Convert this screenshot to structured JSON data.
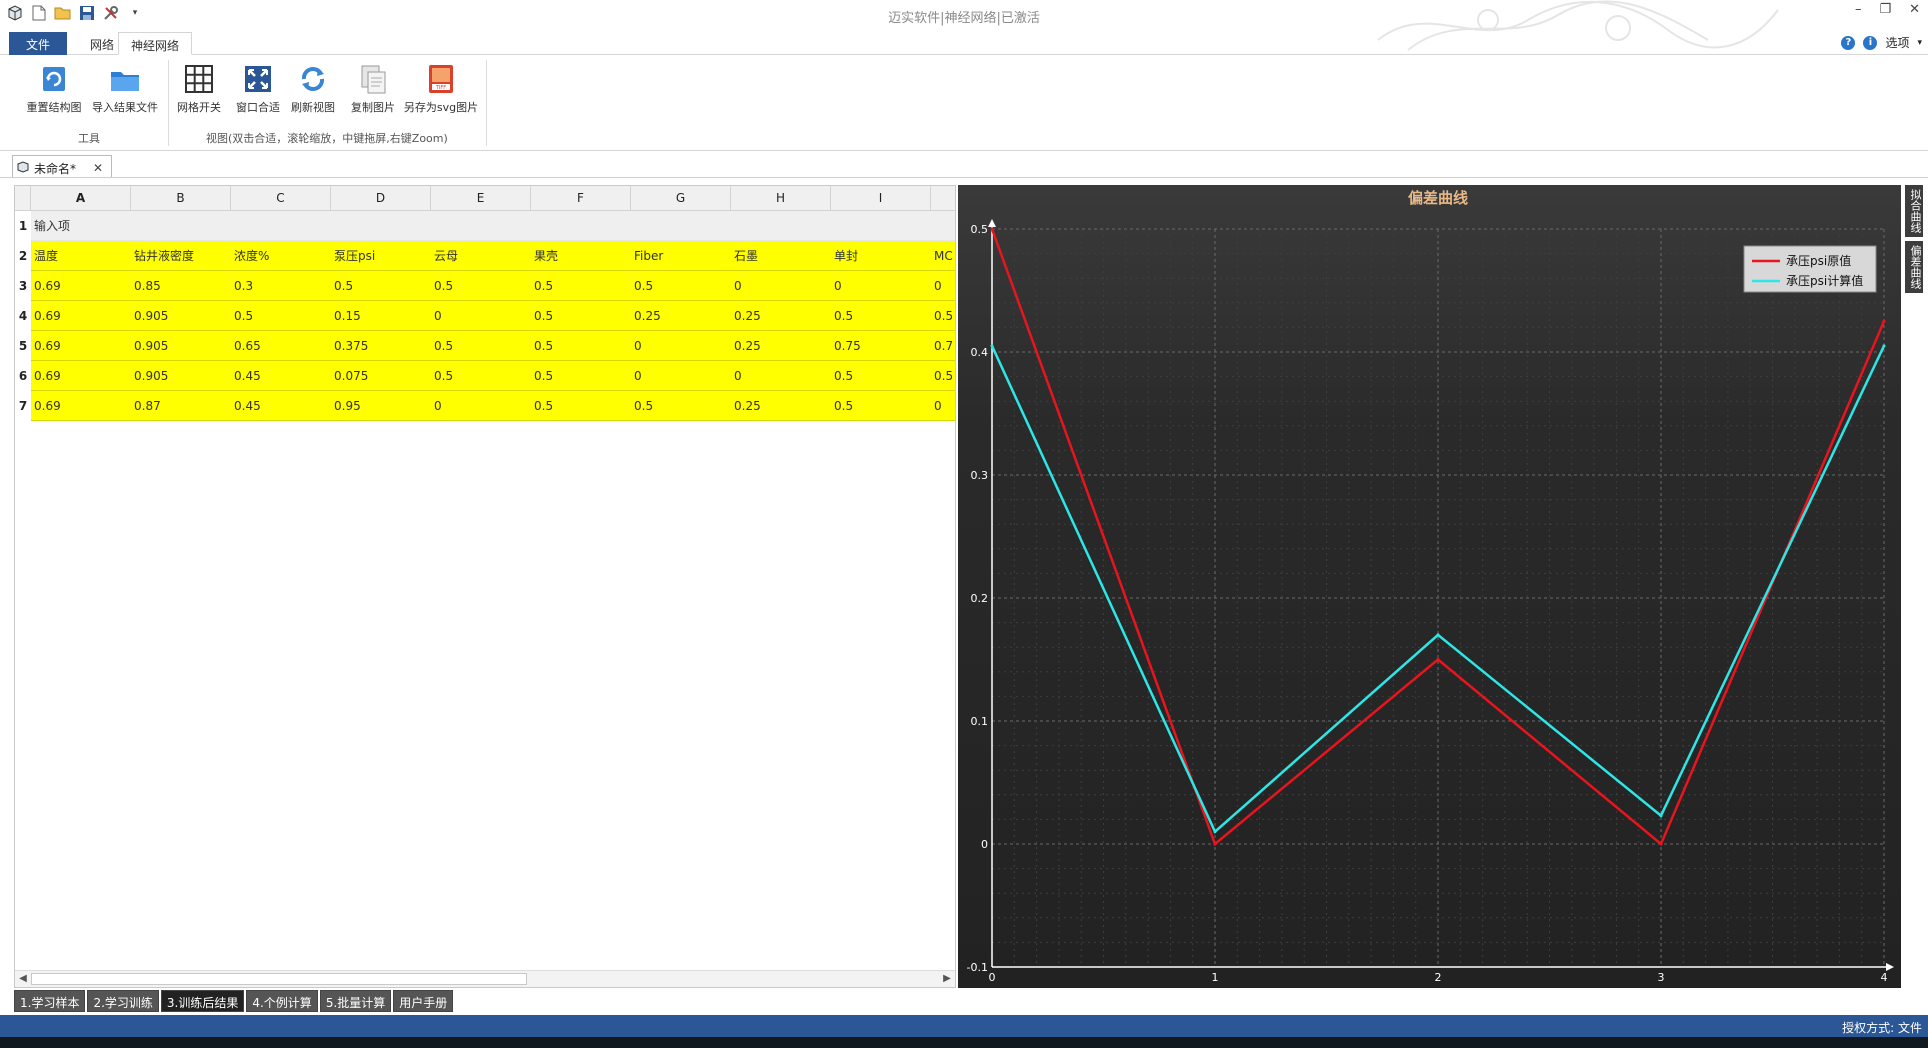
{
  "window": {
    "title": "迈实软件|神经网络|已激活",
    "controls": [
      "–",
      "❐",
      "✕"
    ]
  },
  "ribbon": {
    "tabs": [
      {
        "label": "文件"
      },
      {
        "label": "网络"
      },
      {
        "label": "神经网络"
      }
    ],
    "options_label": "选项",
    "buttons": {
      "reset_structure": "重置结构图",
      "import_result": "导入结果文件",
      "grid_toggle": "网格开关",
      "fit_window": "窗口合适",
      "refresh_view": "刷新视图",
      "copy_image": "复制图片",
      "save_svg": "另存为svg图片"
    },
    "groups": {
      "tools": "工具",
      "view": "视图(双击合适，滚轮缩放，中键拖屏,右键Zoom)"
    }
  },
  "doc_tab": {
    "label": "未命名*"
  },
  "sheet": {
    "columns": [
      "A",
      "B",
      "C",
      "D",
      "E",
      "F",
      "G",
      "H",
      "I"
    ],
    "row_numbers": [
      "1",
      "2",
      "3",
      "4",
      "5",
      "6",
      "7"
    ],
    "row1": "输入项",
    "headers": [
      "温度",
      "钻井液密度",
      "浓度%",
      "泵压psi",
      "云母",
      "果壳",
      "Fiber",
      "石墨",
      "单封",
      "MC"
    ],
    "rows": [
      [
        "0.69",
        "0.85",
        "0.3",
        "0.5",
        "0.5",
        "0.5",
        "0.5",
        "0",
        "0",
        "0"
      ],
      [
        "0.69",
        "0.905",
        "0.5",
        "0.15",
        "0",
        "0.5",
        "0.25",
        "0.25",
        "0.5",
        "0.5"
      ],
      [
        "0.69",
        "0.905",
        "0.65",
        "0.375",
        "0.5",
        "0.5",
        "0",
        "0.25",
        "0.75",
        "0.7"
      ],
      [
        "0.69",
        "0.905",
        "0.45",
        "0.075",
        "0.5",
        "0.5",
        "0",
        "0",
        "0.5",
        "0.5"
      ],
      [
        "0.69",
        "0.87",
        "0.45",
        "0.95",
        "0",
        "0.5",
        "0.5",
        "0.25",
        "0.5",
        "0"
      ]
    ]
  },
  "side_tabs": [
    "拟合曲线",
    "偏差曲线"
  ],
  "bottom_tabs": [
    {
      "label": "1.学习样本"
    },
    {
      "label": "2.学习训练"
    },
    {
      "label": "3.训练后结果"
    },
    {
      "label": "4.个例计算"
    },
    {
      "label": "5.批量计算"
    },
    {
      "label": "用户手册"
    }
  ],
  "status": {
    "text": "授权方式: 文件"
  },
  "colors": {
    "accent": "#2b5797",
    "highlight": "#ffff00",
    "series_red": "#e8141e",
    "series_cyan": "#2ee6e6",
    "chart_title": "#e8b888"
  },
  "chart_data": {
    "type": "line",
    "title": "偏差曲线",
    "x": [
      0,
      1,
      2,
      3,
      4
    ],
    "series": [
      {
        "name": "承压psi原值",
        "color": "#e8141e",
        "values": [
          0.5,
          0.0,
          0.15,
          0.0,
          0.425
        ]
      },
      {
        "name": "承压psi计算值",
        "color": "#2ee6e6",
        "values": [
          0.405,
          0.01,
          0.17,
          0.023,
          0.405
        ]
      }
    ],
    "xlim": [
      0,
      4
    ],
    "ylim": [
      -0.1,
      0.5
    ],
    "xticks": [
      "0",
      "1",
      "2",
      "3",
      "4"
    ],
    "yticks": [
      "-0.1",
      "0",
      "0.1",
      "0.2",
      "0.3",
      "0.4",
      "0.5"
    ],
    "grid": true,
    "legend_position": "top-right"
  }
}
